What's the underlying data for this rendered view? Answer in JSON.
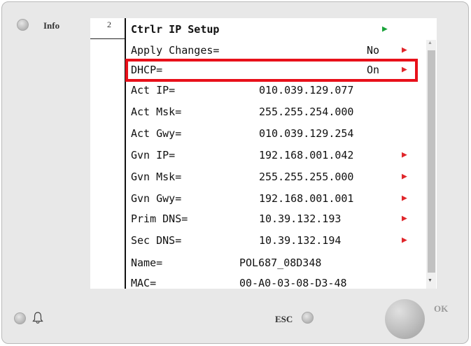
{
  "header": {
    "info_label": "Info",
    "line_number": "2"
  },
  "screen": {
    "title": "Ctrlr IP Setup",
    "rows": [
      {
        "label": "Apply Changes=",
        "value": "No",
        "arrow": true
      },
      {
        "label": "DHCP=",
        "value": "On",
        "arrow": true
      },
      {
        "label": "Act IP=",
        "value": "010.039.129.077",
        "arrow": false
      },
      {
        "label": "Act Msk=",
        "value": "255.255.254.000",
        "arrow": false
      },
      {
        "label": "Act Gwy=",
        "value": "010.039.129.254",
        "arrow": false
      },
      {
        "label": "Gvn IP=",
        "value": "192.168.001.042",
        "arrow": true
      },
      {
        "label": "Gvn Msk=",
        "value": "255.255.255.000",
        "arrow": true
      },
      {
        "label": "Gvn Gwy=",
        "value": "192.168.001.001",
        "arrow": true
      },
      {
        "label": "Prim DNS=",
        "value": "10.39.132.193",
        "arrow": true
      },
      {
        "label": "Sec DNS=",
        "value": "10.39.132.194",
        "arrow": true
      },
      {
        "label": "Name=",
        "value": "POL687_08D348",
        "arrow": false
      },
      {
        "label": "MAC=",
        "value": "00-A0-03-08-D3-48",
        "arrow": false
      }
    ]
  },
  "footer": {
    "esc_label": "ESC",
    "ok_label": "OK"
  },
  "colors": {
    "highlight": "#e8101a",
    "arrow": "#e0262b",
    "title_arrow": "#1aa33a"
  }
}
